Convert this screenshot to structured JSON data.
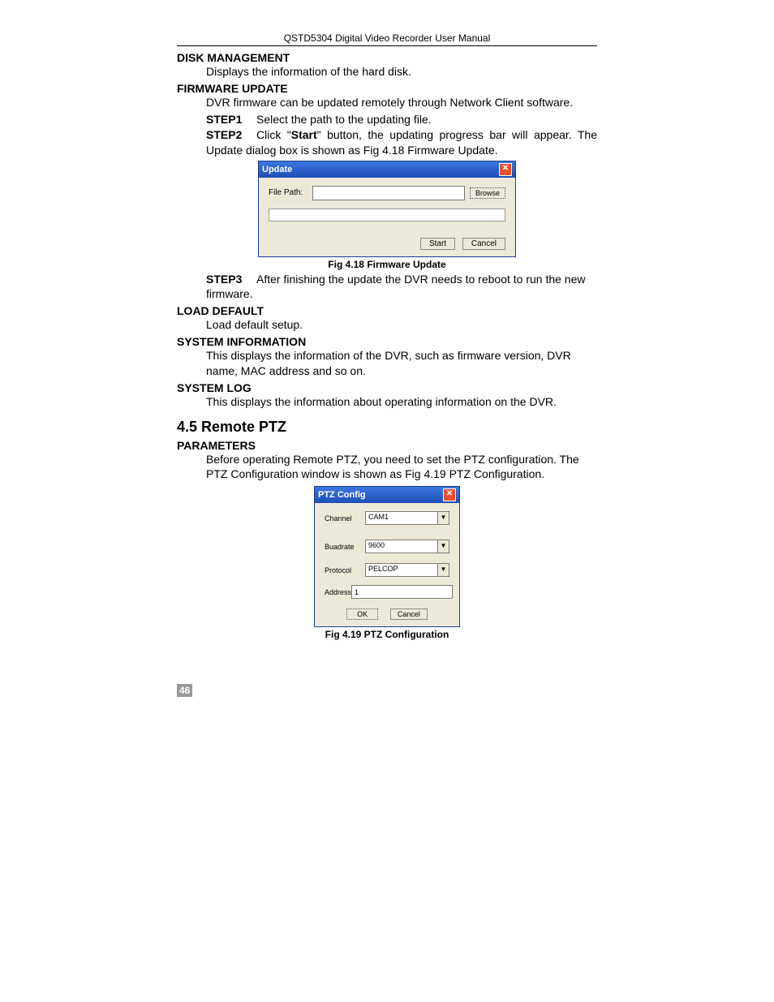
{
  "header": "QSTD5304 Digital Video Recorder User Manual",
  "sections": {
    "disk_mgmt": {
      "heading": "DISK MANAGEMENT",
      "text": "Displays the information of the hard disk."
    },
    "firmware": {
      "heading": "FIRMWARE UPDATE",
      "intro": "DVR firmware can be updated remotely through Network Client software.",
      "step1_label": "STEP1",
      "step1_text": "Select the path to the updating file.",
      "step2_label": "STEP2",
      "step2_pre": "Click \"",
      "step2_strong": "Start",
      "step2_post": "\" button, the updating progress bar will appear. The Update dialog box is shown as Fig 4.18 Firmware Update.",
      "step3_label": "STEP3",
      "step3_text": "After finishing the update the DVR needs to reboot to run the new firmware."
    },
    "load_default": {
      "heading": "LOAD DEFAULT",
      "text": "Load default setup."
    },
    "sys_info": {
      "heading": "SYSTEM INFORMATION",
      "text": "This displays the information of the DVR, such as firmware version, DVR name, MAC address and so on."
    },
    "sys_log": {
      "heading": "SYSTEM LOG",
      "text": "This displays the information about operating information on the DVR."
    },
    "remote_ptz": {
      "heading": "4.5 Remote PTZ",
      "sub": "PARAMETERS",
      "text": "Before operating Remote PTZ, you need to set the PTZ configuration. The PTZ Configuration window is shown as Fig 4.19 PTZ Configuration."
    }
  },
  "update_dialog": {
    "title": "Update",
    "file_label": "File Path:",
    "file_value": "",
    "browse": "Browse",
    "start": "Start",
    "cancel": "Cancel",
    "caption": "Fig 4.18 Firmware Update"
  },
  "ptz_dialog": {
    "title": "PTZ Config",
    "channel_label": "Channel",
    "channel_value": "CAM1",
    "baud_label": "Buadrate",
    "baud_value": "9600",
    "protocol_label": "Protocol",
    "protocol_value": "PELCOP",
    "address_label": "Address",
    "address_value": "1",
    "ok": "OK",
    "cancel": "Cancel",
    "caption": "Fig 4.19 PTZ Configuration"
  },
  "page_number": "46"
}
